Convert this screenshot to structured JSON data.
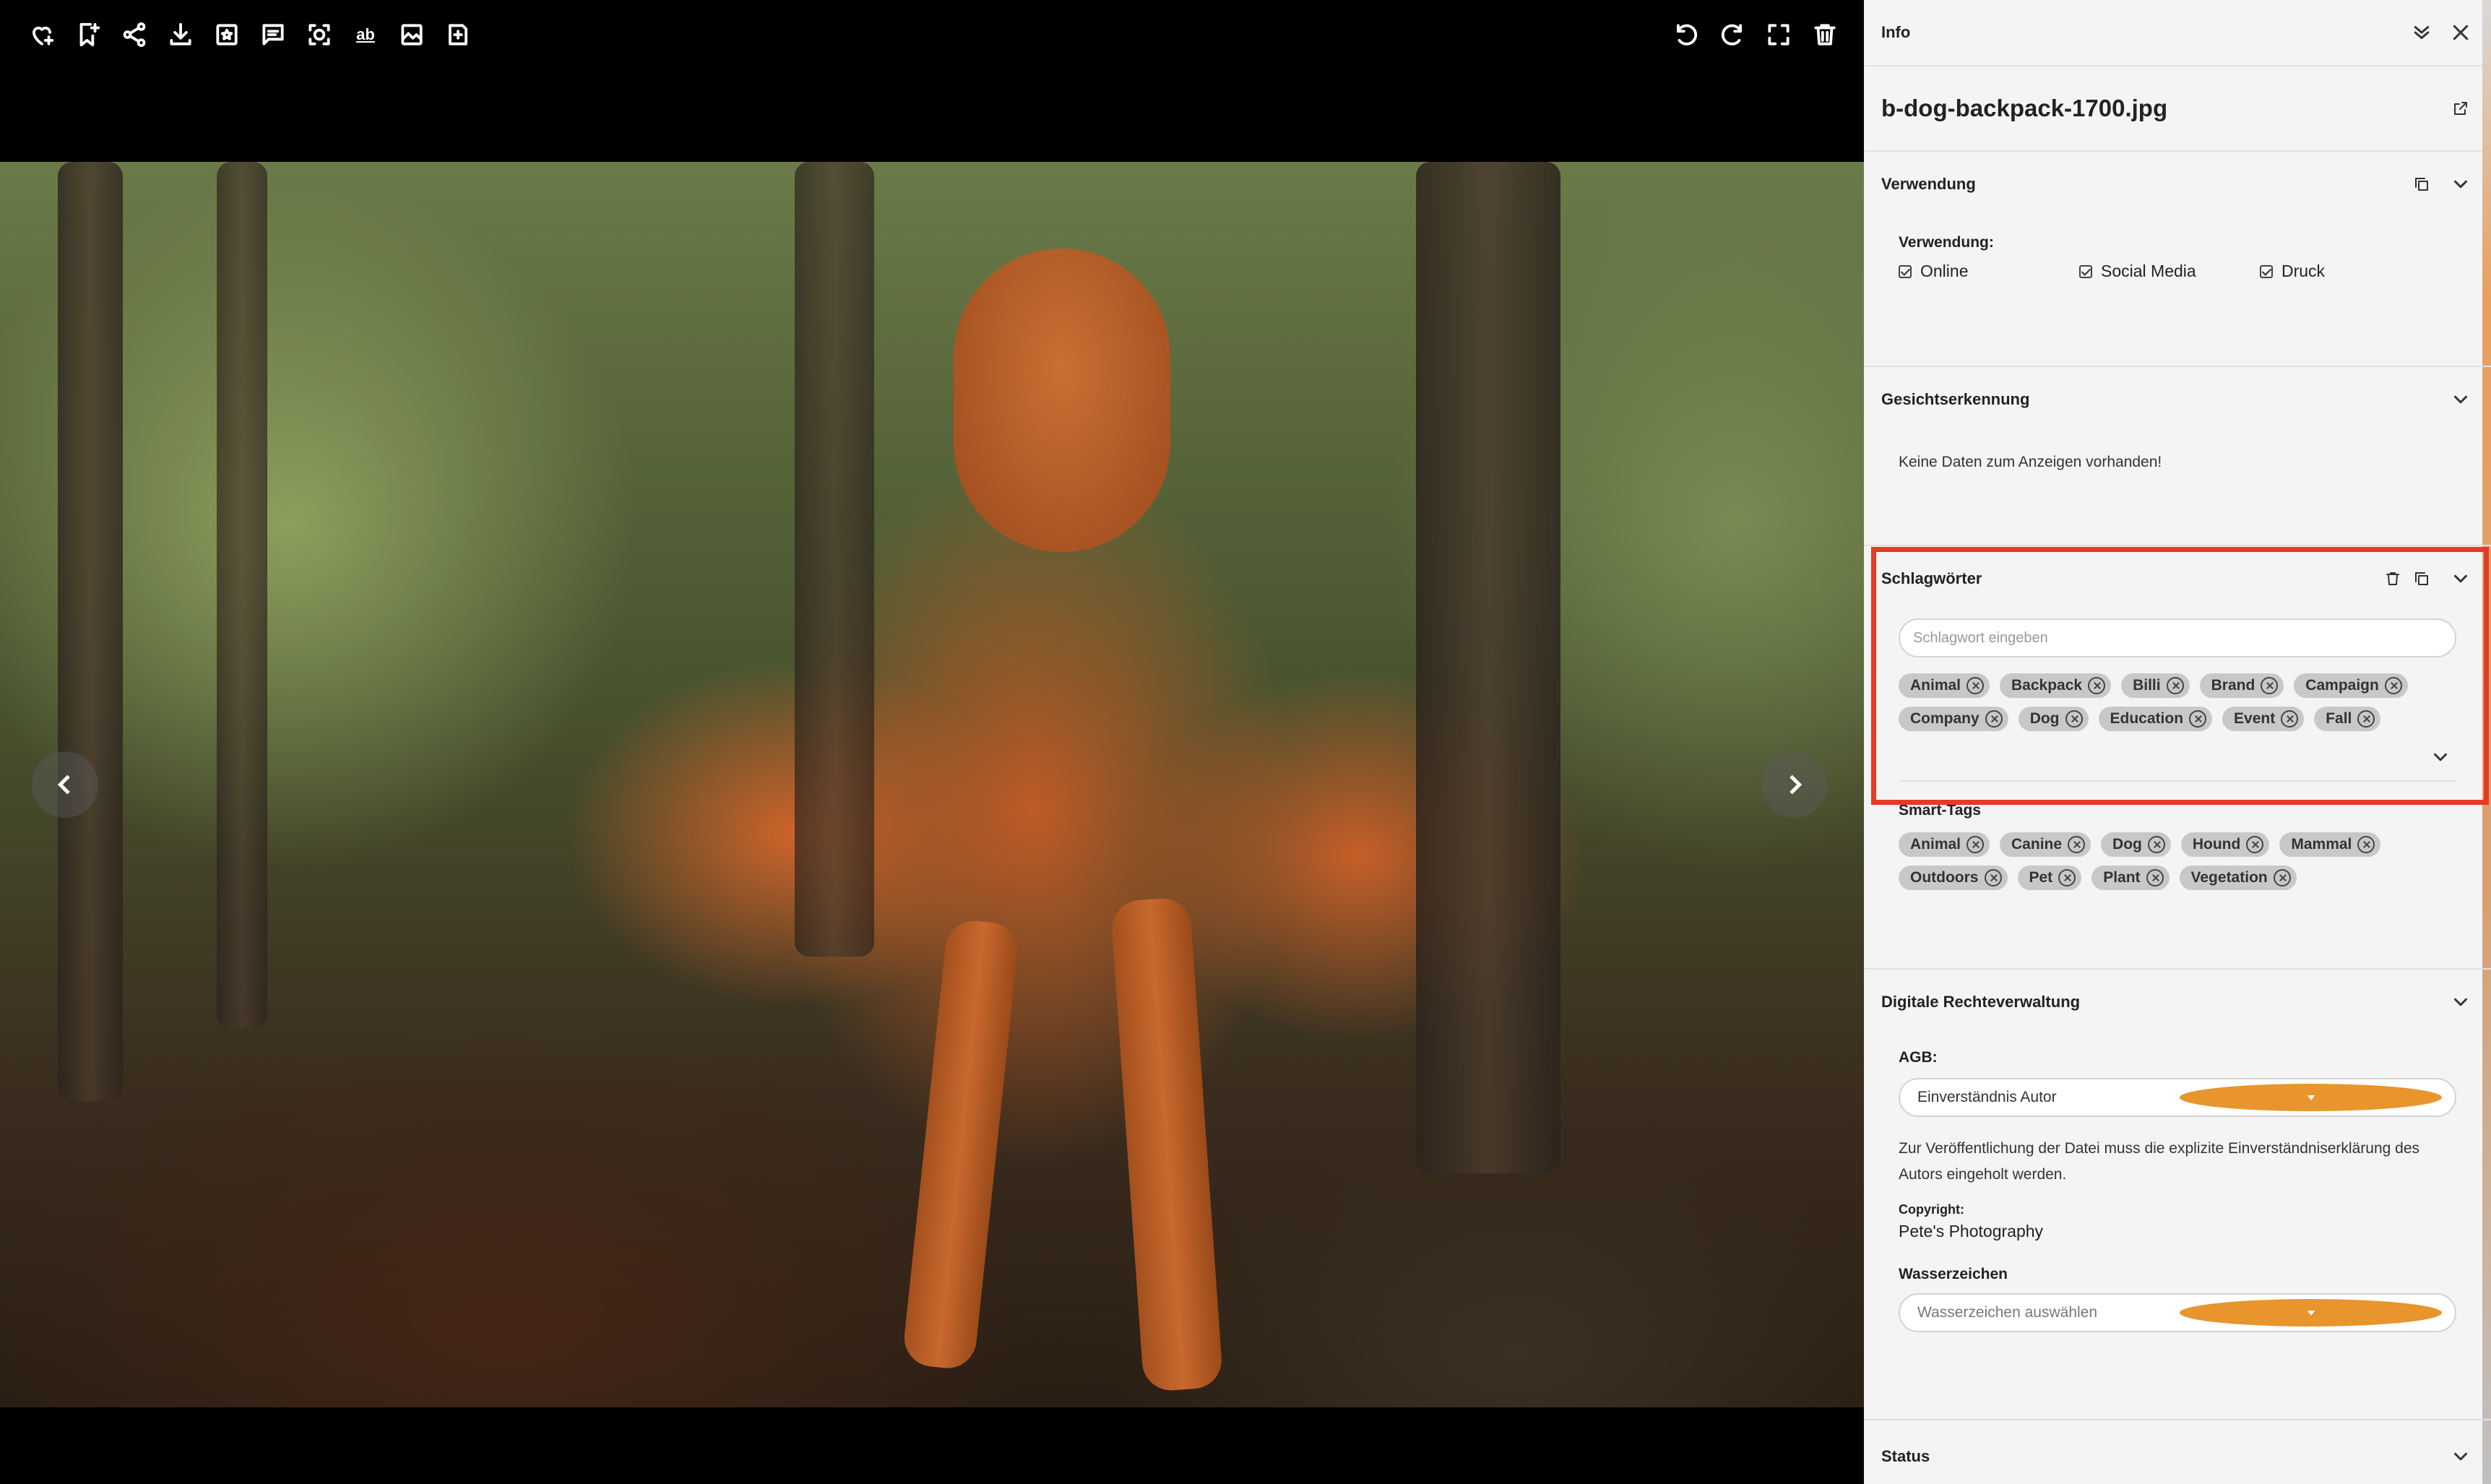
{
  "toolbar_left": [
    "heart-plus-icon",
    "bookmark-add-icon",
    "share-icon",
    "download-icon",
    "star-box-icon",
    "comment-icon",
    "face-scan-icon",
    "text-recognition-icon",
    "image-edit-icon",
    "save-copy-icon"
  ],
  "toolbar_right": [
    "rotate-left-icon",
    "rotate-right-icon",
    "fullscreen-icon",
    "trash-icon"
  ],
  "ocr_label": "ab",
  "panel": {
    "title": "Info",
    "filename": "b-dog-backpack-1700.jpg",
    "verwendung": {
      "heading": "Verwendung",
      "label": "Verwendung:",
      "options": [
        "Online",
        "Social Media",
        "Druck"
      ]
    },
    "gesicht": {
      "heading": "Gesichtserkennung",
      "empty": "Keine Daten zum Anzeigen vorhanden!"
    },
    "schlag": {
      "heading": "Schlagwörter",
      "placeholder": "Schlagwort eingeben",
      "tags": [
        "Animal",
        "Backpack",
        "Billi",
        "Brand",
        "Campaign",
        "Company",
        "Dog",
        "Education",
        "Event",
        "Fall"
      ]
    },
    "smart": {
      "heading": "Smart-Tags",
      "tags": [
        "Animal",
        "Canine",
        "Dog",
        "Hound",
        "Mammal",
        "Outdoors",
        "Pet",
        "Plant",
        "Vegetation"
      ]
    },
    "drm": {
      "heading": "Digitale Rechteverwaltung",
      "agb_label": "AGB:",
      "agb_value": "Einverständnis Autor",
      "note": "Zur Veröffentlichung der Datei muss die explizite Einverständniserklärung des Autors eingeholt werden.",
      "copyright_label": "Copyright:",
      "copyright_value": "Pete's Photography",
      "wasser_label": "Wasserzeichen",
      "wasser_placeholder": "Wasserzeichen auswählen"
    },
    "status": {
      "heading": "Status"
    }
  },
  "colors": {
    "accent": "#e8952e",
    "highlight": "#e53a25"
  }
}
